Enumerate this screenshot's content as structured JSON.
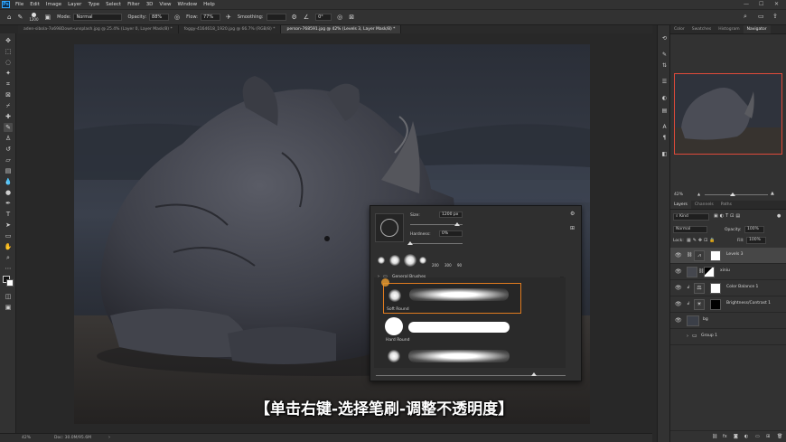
{
  "menu": {
    "logo": "Ps",
    "items": [
      "File",
      "Edit",
      "Image",
      "Layer",
      "Type",
      "Select",
      "Filter",
      "3D",
      "View",
      "Window",
      "Help"
    ],
    "window_controls": [
      "—",
      "☐",
      "✕"
    ]
  },
  "options": {
    "brush_size": "1200",
    "mode_label": "Mode:",
    "mode_value": "Normal",
    "opacity_label": "Opacity:",
    "opacity_value": "88%",
    "flow_label": "Flow:",
    "flow_value": "77%",
    "smoothing_label": "Smoothing:",
    "smoothing_value": "",
    "angle_value": "0°"
  },
  "tabs": [
    "aden-sibola-7o698Down-unsplash.jpg @ 25.4% (Layer 0, Layer Mask/8) *",
    "foggy-4164618_1920.jpg @ 66.7% (RGB/8) *",
    "person-768591.jpg @ 42% (Levels 3, Layer Mask/8) *"
  ],
  "status": {
    "zoom": "42%",
    "doc": "Doc: 30.0M/95.6M"
  },
  "subtitle": "【单击右键-选择笔刷-调整不透明度】",
  "brush_popup": {
    "size_label": "Size:",
    "size_value": "1200 px",
    "hardness_label": "Hardness:",
    "hardness_value": "0%",
    "size_fraction": 0.9,
    "hardness_fraction": 0.0,
    "recent_sizes": [
      "200",
      "300",
      "90"
    ],
    "folder_label": "General Brushes",
    "brushes": [
      {
        "label": "Soft Round",
        "selected": true
      },
      {
        "label": "Hard Round",
        "selected": false
      },
      {
        "label": "",
        "selected": false
      }
    ]
  },
  "right_panel": {
    "top_tabs": [
      "Color",
      "Swatches",
      "Histogram",
      "Navigator"
    ],
    "active_top_tab": "Navigator",
    "nav_zoom": "42%",
    "layer_tabs": [
      "Layers",
      "Channels",
      "Paths"
    ],
    "kind_label": "Kind",
    "blend_mode": "Normal",
    "opacity_label": "Opacity:",
    "opacity_value": "100%",
    "lock_label": "Lock:",
    "fill_label": "Fill:",
    "fill_value": "100%",
    "layers": [
      {
        "name": "Levels 3",
        "selected": true
      },
      {
        "name": "xiniu",
        "selected": false
      },
      {
        "name": "Color Balance 1",
        "selected": false
      },
      {
        "name": "Brightness/Contrast 1",
        "selected": false
      },
      {
        "name": "bg",
        "selected": false
      },
      {
        "name": "Group 1",
        "selected": false
      }
    ],
    "bottom_icons": [
      "link-icon",
      "fx-icon",
      "mask-icon",
      "adjustment-icon",
      "folder-icon",
      "new-layer-icon",
      "trash-icon"
    ]
  },
  "colors": {
    "accent": "#31a8ff",
    "selection_orange": "#e07b1f",
    "navigator_frame": "#e04a3a"
  }
}
